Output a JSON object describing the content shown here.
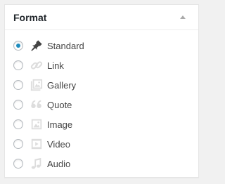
{
  "panel": {
    "title": "Format",
    "toggle_icon": "triangle-up-icon"
  },
  "formats": [
    {
      "label": "Standard",
      "icon": "pin-icon",
      "selected": true
    },
    {
      "label": "Link",
      "icon": "link-icon",
      "selected": false
    },
    {
      "label": "Gallery",
      "icon": "gallery-icon",
      "selected": false
    },
    {
      "label": "Quote",
      "icon": "quote-icon",
      "selected": false
    },
    {
      "label": "Image",
      "icon": "image-icon",
      "selected": false
    },
    {
      "label": "Video",
      "icon": "video-icon",
      "selected": false
    },
    {
      "label": "Audio",
      "icon": "audio-icon",
      "selected": false
    }
  ],
  "colors": {
    "radio_selected": "#1e8cbe",
    "icon_active": "#444444",
    "icon_inactive": "#dddddd"
  }
}
